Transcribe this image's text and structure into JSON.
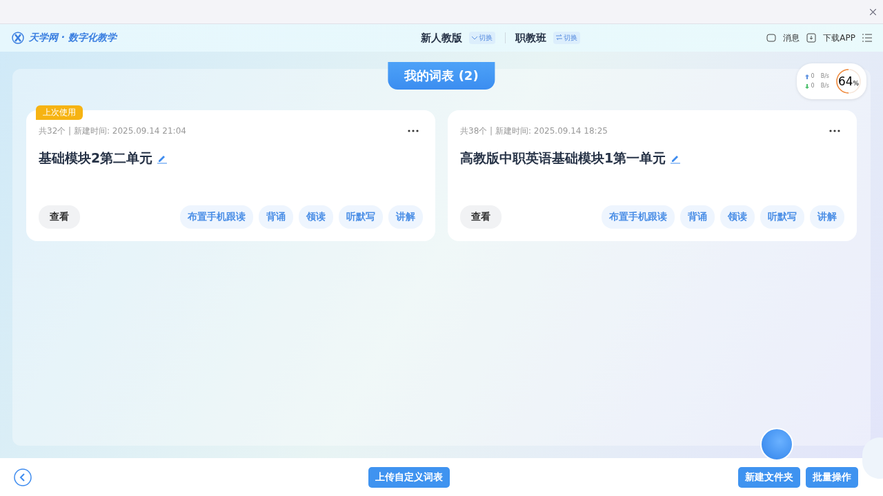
{
  "header": {
    "logo": "天学网 · 数字化教学",
    "editions": [
      {
        "name": "新人教版",
        "switch": "切换",
        "kind": "dropdown"
      },
      {
        "name": "职教班",
        "switch": "切换",
        "kind": "swap"
      }
    ],
    "actions": [
      {
        "label": "消息",
        "kind": "message"
      },
      {
        "label": "下载APP",
        "kind": "download"
      }
    ]
  },
  "title": "我的词表 (2)",
  "network": {
    "up": "0",
    "up_unit": "B/s",
    "down": "0",
    "down_unit": "B/s",
    "usage": "64",
    "percent": "%"
  },
  "cards": [
    {
      "badge": "上次使用",
      "meta": "共32个 | 新建时间: 2025.09.14 21:04",
      "name": "基础模块2第二单元",
      "view": "查看",
      "actions": [
        "布置手机跟读",
        "背诵",
        "领读",
        "听默写",
        "讲解"
      ]
    },
    {
      "meta": "共38个 | 新建时间: 2025.09.14 18:25",
      "name": "高教版中职英语基础模块1第一单元",
      "view": "查看",
      "actions": [
        "布置手机跟读",
        "背诵",
        "领读",
        "听默写",
        "讲解"
      ]
    }
  ],
  "footer": {
    "upload": "上传自定义词表",
    "buttons": [
      "新建文件夹",
      "批量操作"
    ]
  }
}
